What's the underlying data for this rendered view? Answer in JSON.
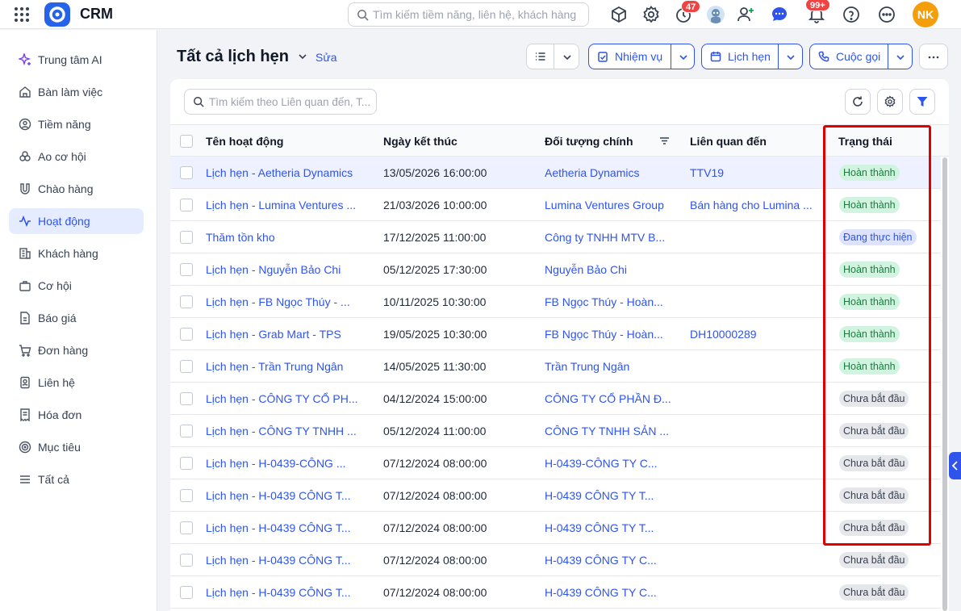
{
  "app": {
    "title": "CRM"
  },
  "topbar": {
    "search_placeholder": "Tìm kiếm tiềm năng, liên hệ, khách hàng",
    "timer_badge": "47",
    "notification_badge": "99+",
    "user_initials": "NK"
  },
  "sidebar": {
    "items": [
      {
        "label": "Trung tâm AI",
        "icon": "sparkle-icon"
      },
      {
        "label": "Bàn làm việc",
        "icon": "home-icon"
      },
      {
        "label": "Tiềm năng",
        "icon": "user-circle-icon"
      },
      {
        "label": "Ao cơ hội",
        "icon": "group-icon"
      },
      {
        "label": "Chào hàng",
        "icon": "magnet-icon"
      },
      {
        "label": "Hoạt động",
        "icon": "activity-icon"
      },
      {
        "label": "Khách hàng",
        "icon": "building-icon"
      },
      {
        "label": "Cơ hội",
        "icon": "briefcase-icon"
      },
      {
        "label": "Báo giá",
        "icon": "quote-doc-icon"
      },
      {
        "label": "Đơn hàng",
        "icon": "cart-icon"
      },
      {
        "label": "Liên hệ",
        "icon": "contact-icon"
      },
      {
        "label": "Hóa đơn",
        "icon": "invoice-icon"
      },
      {
        "label": "Mục tiêu",
        "icon": "target-icon"
      },
      {
        "label": "Tất cả",
        "icon": "menu-icon"
      }
    ],
    "active_index": 5
  },
  "header": {
    "title": "Tất cả lịch hẹn",
    "edit_label": "Sửa",
    "task_label": "Nhiệm vụ",
    "appointment_label": "Lịch hẹn",
    "call_label": "Cuộc gọi"
  },
  "table": {
    "search_placeholder": "Tìm kiếm theo Liên quan đến, T...",
    "columns": [
      "Tên hoạt động",
      "Ngày kết thúc",
      "Đối tượng chính",
      "Liên quan đến",
      "Trạng thái"
    ],
    "rows": [
      {
        "name": "Lịch hẹn - Aetheria Dynamics",
        "end": "13/05/2026 16:00:00",
        "target": "Aetheria Dynamics",
        "related": "TTV19",
        "status": "Hoàn thành",
        "kind": "done"
      },
      {
        "name": "Lịch hẹn - Lumina Ventures ...",
        "end": "21/03/2026 10:00:00",
        "target": "Lumina Ventures Group",
        "related": "Bán hàng cho Lumina ...",
        "status": "Hoàn thành",
        "kind": "done"
      },
      {
        "name": "Thăm tồn kho",
        "end": "17/12/2025 11:00:00",
        "target": "Công ty TNHH MTV B...",
        "related": "",
        "status": "Đang thực hiện",
        "kind": "prog"
      },
      {
        "name": "Lịch hẹn - Nguyễn Bảo Chi",
        "end": "05/12/2025 17:30:00",
        "target": "Nguyễn Bảo Chi",
        "related": "",
        "status": "Hoàn thành",
        "kind": "done"
      },
      {
        "name": "Lịch hẹn - FB Ngọc Thúy - ...",
        "end": "10/11/2025 10:30:00",
        "target": "FB Ngọc Thúy - Hoàn...",
        "related": "",
        "status": "Hoàn thành",
        "kind": "done"
      },
      {
        "name": "Lịch hẹn - Grab Mart - TPS",
        "end": "19/05/2025 10:30:00",
        "target": "FB Ngọc Thúy - Hoàn...",
        "related": "DH10000289",
        "status": "Hoàn thành",
        "kind": "done"
      },
      {
        "name": "Lịch hẹn - Trần Trung Ngân",
        "end": "14/05/2025 11:30:00",
        "target": "Trần Trung Ngân",
        "related": "",
        "status": "Hoàn thành",
        "kind": "done"
      },
      {
        "name": "Lịch hẹn - CÔNG TY CỔ PH...",
        "end": "04/12/2024 15:00:00",
        "target": "CÔNG TY CỔ PHẦN Đ...",
        "related": "",
        "status": "Chưa bắt đầu",
        "kind": "todo"
      },
      {
        "name": "Lịch hẹn - CÔNG TY TNHH ...",
        "end": "05/12/2024 11:00:00",
        "target": "CÔNG TY TNHH SẢN ...",
        "related": "",
        "status": "Chưa bắt đầu",
        "kind": "todo"
      },
      {
        "name": "Lịch hẹn - H-0439-CÔNG ...",
        "end": "07/12/2024 08:00:00",
        "target": "H-0439-CÔNG TY C...",
        "related": "",
        "status": "Chưa bắt đầu",
        "kind": "todo"
      },
      {
        "name": "Lịch hẹn - H-0439 CÔNG T...",
        "end": "07/12/2024 08:00:00",
        "target": "H-0439 CÔNG TY T...",
        "related": "",
        "status": "Chưa bắt đầu",
        "kind": "todo"
      },
      {
        "name": "Lịch hẹn - H-0439 CÔNG T...",
        "end": "07/12/2024 08:00:00",
        "target": "H-0439 CÔNG TY T...",
        "related": "",
        "status": "Chưa bắt đầu",
        "kind": "todo"
      },
      {
        "name": "Lịch hẹn - H-0439 CÔNG T...",
        "end": "07/12/2024 08:00:00",
        "target": "H-0439 CÔNG TY C...",
        "related": "",
        "status": "Chưa bắt đầu",
        "kind": "todo"
      },
      {
        "name": "Lịch hẹn - H-0439 CÔNG T...",
        "end": "07/12/2024 08:00:00",
        "target": "H-0439 CÔNG TY C...",
        "related": "",
        "status": "Chưa bắt đầu",
        "kind": "todo"
      }
    ],
    "selected_row": 0
  }
}
